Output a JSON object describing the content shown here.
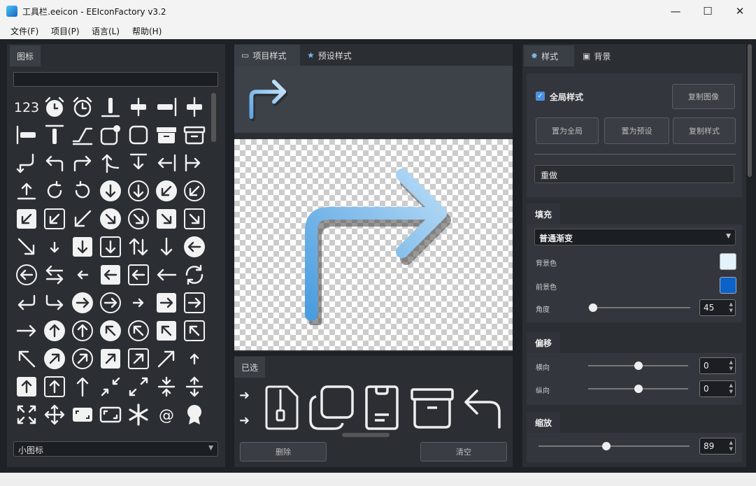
{
  "window": {
    "title": "工具栏.eeicon - EEIconFactory v3.2",
    "minimize_glyph": "—",
    "maximize_glyph": "☐",
    "close_glyph": "✕"
  },
  "menu": {
    "file": "文件(F)",
    "project": "项目(P)",
    "language": "语言(L)",
    "help": "帮助(H)"
  },
  "left_panel": {
    "tab_label": "图标",
    "search_value": "",
    "size_select": "小图标",
    "icons": [
      [
        "numbers-123",
        "alarm",
        "alarm-outline",
        "align-bottom-bar",
        "align-center-h",
        "align-center-v",
        "align-right-bar"
      ],
      [
        "align-left-bar",
        "align-top-bar",
        "angle",
        "app-badge",
        "app-outline",
        "archive",
        "archive-outline"
      ],
      [
        "arrow-down-left-turn",
        "arrow-up-left-turn",
        "arrow-up-right-turn",
        "arrow-up-left-corner",
        "arrow-down-bar",
        "arrow-left-bar",
        "arrow-right-bar"
      ],
      [
        "arrow-upload",
        "arrow-clockwise",
        "arrow-counterclockwise",
        "arrow-circle-down-filled",
        "arrow-circle-down",
        "arrow-circle-down-left-filled",
        "arrow-circle-down-left"
      ],
      [
        "arrow-square-down-left-filled",
        "arrow-square-down-left",
        "arrow-down-left",
        "arrow-circle-down-right-filled",
        "arrow-circle-down-right",
        "arrow-square-down-right-filled",
        "arrow-square-down-right"
      ],
      [
        "arrow-down-right",
        "arrow-down-small",
        "arrow-square-down-filled",
        "arrow-square-down",
        "arrow-sort",
        "arrow-down",
        "arrow-circle-left-filled"
      ],
      [
        "arrow-circle-left",
        "arrow-swap",
        "arrow-left-small",
        "arrow-square-left-filled",
        "arrow-square-left",
        "arrow-left",
        "arrow-sync"
      ],
      [
        "arrow-enter-left",
        "arrow-enter-right",
        "arrow-circle-right-filled",
        "arrow-circle-right",
        "arrow-right-small",
        "arrow-square-right-filled",
        "arrow-square-right"
      ],
      [
        "arrow-right",
        "arrow-circle-up-filled",
        "arrow-circle-up",
        "arrow-circle-up-left-filled",
        "arrow-circle-up-left",
        "arrow-square-up-left-filled",
        "arrow-square-up-left"
      ],
      [
        "arrow-up-left",
        "arrow-circle-up-right-filled",
        "arrow-circle-up-right",
        "arrow-square-up-right-filled",
        "arrow-square-up-right",
        "arrow-up-right",
        "arrow-up-small"
      ],
      [
        "arrow-square-up-filled",
        "arrow-square-up",
        "arrow-up",
        "arrow-minimize",
        "arrow-maximize",
        "arrow-collapse-v",
        "arrow-expand-v"
      ],
      [
        "arrow-expand",
        "arrow-move",
        "aspect-ratio-filled",
        "aspect-ratio",
        "asterisk",
        "at-sign",
        "award"
      ]
    ]
  },
  "center": {
    "tab_item_style": "项目样式",
    "tab_preset_style": "预设样式",
    "selected_label": "已选",
    "delete_button": "删除",
    "clear_button": "清空",
    "selected_icons": [
      "zip-file-icon",
      "copy-icon",
      "id-badge-icon",
      "archive-icon",
      "arrow-undo-icon"
    ]
  },
  "right": {
    "tab_style": "样式",
    "tab_background": "背景",
    "global_style_label": "全局样式",
    "global_style_checked": true,
    "copy_image": "复制图像",
    "set_global": "置为全局",
    "set_preset": "置为预设",
    "copy_style": "复制样式",
    "redo": "重做",
    "fill_title": "填充",
    "fill_mode": "普通渐变",
    "bg_color_label": "背景色",
    "fg_color_label": "前景色",
    "angle_label": "角度",
    "angle_value": "45",
    "angle_fraction": 0.05,
    "bg_color": "#e3f2fb",
    "fg_color": "#0b63c9",
    "offset_title": "偏移",
    "horizontal_label": "横向",
    "horizontal_value": "0",
    "horizontal_fraction": 0.5,
    "vertical_label": "纵向",
    "vertical_value": "0",
    "vertical_fraction": 0.5,
    "scale_title": "缩放",
    "scale_value": "89",
    "scale_fraction": 0.45
  },
  "colors": {
    "accent": "#4a90e2",
    "gradient_start": "#a8d8f8",
    "gradient_end": "#3d8fd8"
  }
}
